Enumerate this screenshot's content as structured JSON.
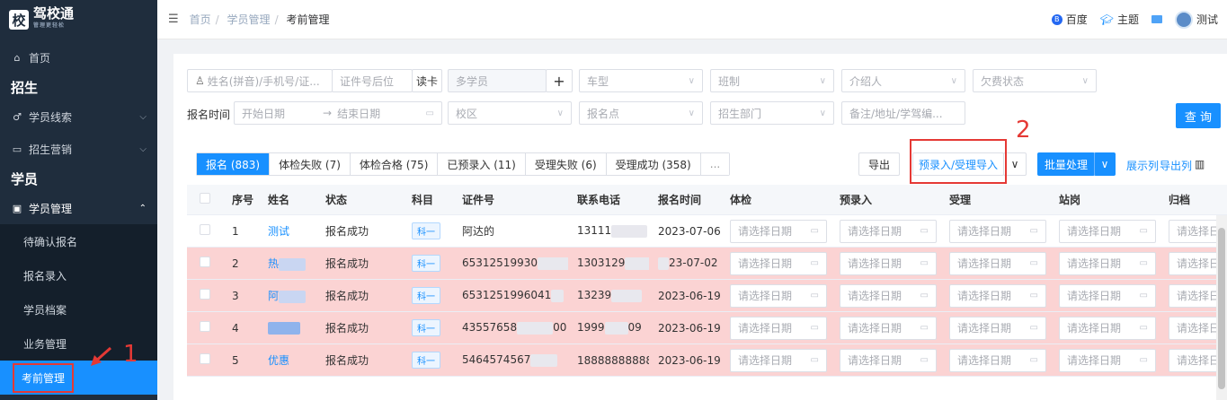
{
  "logo": {
    "badge": "校",
    "title": "驾校通",
    "subtitle": "管理更轻松"
  },
  "sidebar": {
    "home": "首页",
    "group1": "招生",
    "leads": "学员线索",
    "marketing": "招生营销",
    "group2": "学员",
    "student_mgmt": "学员管理",
    "subs": [
      "待确认报名",
      "报名录入",
      "学员档案",
      "业务管理",
      "考前管理"
    ]
  },
  "header": {
    "breadcrumb": [
      "首页",
      "学员管理",
      "考前管理"
    ],
    "baidu": "百度",
    "theme": "主题",
    "user": "测试"
  },
  "filters": {
    "name_ph": "姓名(拼音)/手机号/证...",
    "id_tail_ph": "证件号后位",
    "read_card": "读卡",
    "multi_student": "多学员",
    "car_type": "车型",
    "class_system": "班制",
    "referrer": "介绍人",
    "arrears": "欠费状态",
    "signup_time_label": "报名时间",
    "start_date": "开始日期",
    "range_sep": "→",
    "end_date": "结束日期",
    "campus": "校区",
    "signup_point": "报名点",
    "dept": "招生部门",
    "remark_ph": "备注/地址/学驾编...",
    "query": "查 询"
  },
  "tabs": [
    "报名 (883)",
    "体检失败 (7)",
    "体检合格 (75)",
    "已预录入 (11)",
    "受理失败 (6)",
    "受理成功 (358)",
    "..."
  ],
  "actions": {
    "export": "导出",
    "pre_import": "预录入/受理导入",
    "batch": "批量处理",
    "show_cols": "展示列",
    "export_cols": "导出列"
  },
  "annotations": {
    "one": "1",
    "two": "2"
  },
  "table": {
    "headers": [
      "序号",
      "姓名",
      "状态",
      "科目",
      "证件号",
      "联系电话",
      "报名时间",
      "体检",
      "预录入",
      "受理",
      "站岗",
      "归档"
    ],
    "date_ph": "请选择日期",
    "rows": [
      {
        "no": "1",
        "name": "测试",
        "status": "报名成功",
        "subject": "科一",
        "id": "阿达的",
        "phone": "13111",
        "time": "2023-07-06"
      },
      {
        "no": "2",
        "name": "热",
        "status": "报名成功",
        "subject": "科一",
        "id": "65312519930",
        "phone": "1303129",
        "time": "23-07-02"
      },
      {
        "no": "3",
        "name": "阿",
        "status": "报名成功",
        "subject": "科一",
        "id": "6531251996041",
        "phone": "13239",
        "time": "2023-06-19"
      },
      {
        "no": "4",
        "name": "",
        "status": "报名成功",
        "subject": "科一",
        "id": "43557658",
        "id_tail": "00",
        "phone": "1999",
        "phone_tail": "09",
        "time": "2023-06-19"
      },
      {
        "no": "5",
        "name": "优惠",
        "status": "报名成功",
        "subject": "科一",
        "id": "5464574567",
        "phone": "18888888888",
        "time": "2023-06-19"
      }
    ]
  },
  "colors": {
    "accent": "#1890ff",
    "sidebar": "#1f2d3d",
    "highlight_row": "#fbd3d3",
    "annotation": "#e53935"
  }
}
